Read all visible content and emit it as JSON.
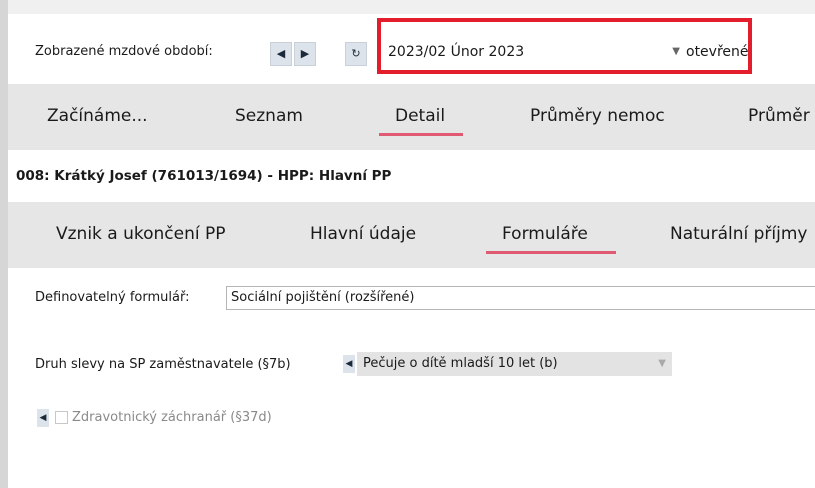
{
  "period_bar": {
    "label": "Zobrazené mzdové období:",
    "prev_icon": "◀",
    "next_icon": "▶",
    "refresh_icon": "↻",
    "period_value": "2023/02 Únor 2023",
    "dropdown_icon": "▼",
    "status": "otevřené"
  },
  "main_tabs": [
    {
      "label": "Začínáme..."
    },
    {
      "label": "Seznam"
    },
    {
      "label": "Detail"
    },
    {
      "label": "Průměry nemoc"
    },
    {
      "label": "Průměr"
    }
  ],
  "employee": {
    "title": "008: Krátký Josef (761013/1694) - HPP: Hlavní PP"
  },
  "sub_tabs": [
    {
      "label": "Vznik a ukončení PP"
    },
    {
      "label": "Hlavní údaje"
    },
    {
      "label": "Formuláře"
    },
    {
      "label": "Naturální příjmy"
    }
  ],
  "form": {
    "definable_label": "Definovatelný formulář:",
    "definable_value": "Sociální pojištění (rozšířené)",
    "discount_label": "Druh slevy na SP zaměstnavatele (§7b)",
    "discount_value": "Pečuje o dítě mladší 10 let (b)",
    "arrow_icon": "◀",
    "dropdown_icon": "▼",
    "rescuer_label": "Zdravotnický záchranář (§37d)",
    "rescuer_checked": false
  },
  "colors": {
    "highlight": "#e31d2b",
    "tab_underline": "#e05a72"
  }
}
